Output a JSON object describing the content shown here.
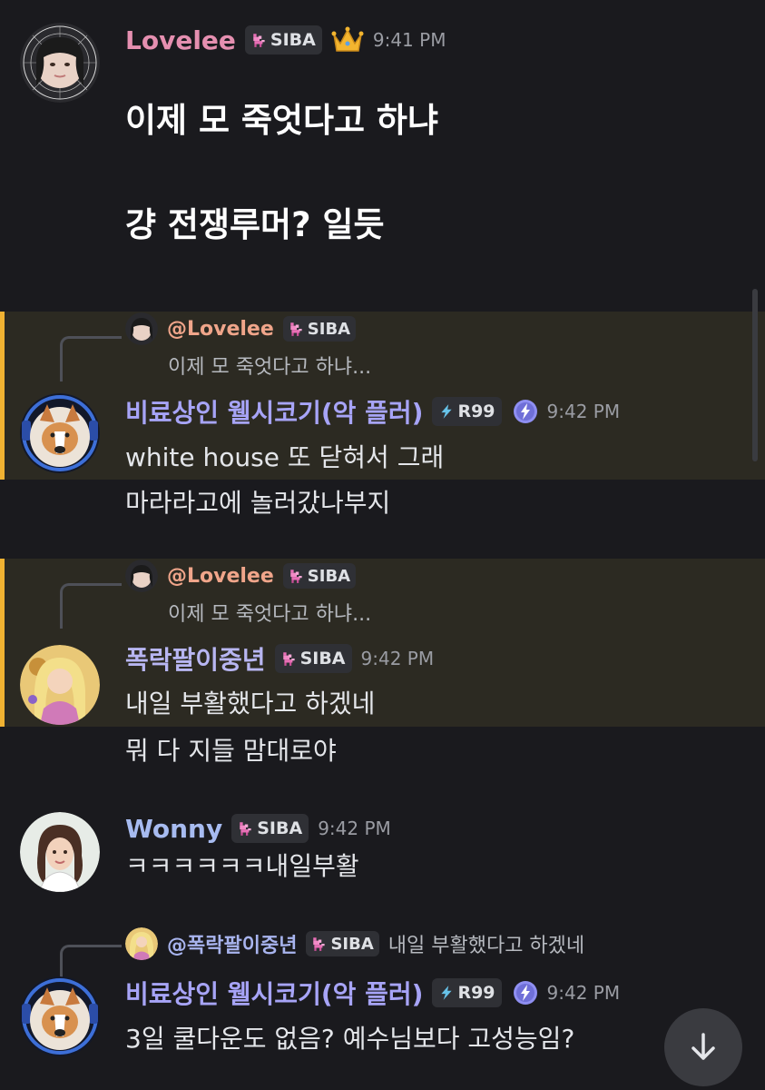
{
  "colors": {
    "lovelee": "#e58fb0",
    "corgi": "#a7a4f7",
    "popak": "#b8b6f2",
    "wonny": "#a7bbf0",
    "reply_lovelee": "#f0a58a",
    "reply_popak": "#a8b4ee",
    "highlight": "#f0b232"
  },
  "messages": [
    {
      "author": "Lovelee",
      "badge": "SIBA",
      "badge_icon": "pink-pixel-dog-icon",
      "extra_icon": "crown-icon",
      "time": "9:41 PM",
      "lines": [
        "이제 모 죽엇다고 하냐",
        "걍 전쟁루머? 일듯"
      ]
    },
    {
      "reply_to": {
        "author": "@Lovelee",
        "badge": "SIBA",
        "preview": "이제 모 죽엇다고 하냐..."
      },
      "author": "비료상인 웰시코기(악 플러)",
      "badge": "R99",
      "badge_icon": "lightning-icon",
      "extra_icon": "boost-icon",
      "time": "9:42 PM",
      "lines": [
        "white house 또 닫혀서 그래",
        "마라라고에 놀러갔나부지"
      ]
    },
    {
      "reply_to": {
        "author": "@Lovelee",
        "badge": "SIBA",
        "preview": "이제 모 죽엇다고 하냐..."
      },
      "author": "폭락팔이중년",
      "badge": "SIBA",
      "badge_icon": "pink-pixel-dog-icon",
      "time": "9:42 PM",
      "lines": [
        "내일 부활했다고 하겠네",
        "뭐 다 지들 맘대로야"
      ]
    },
    {
      "author": "Wonny",
      "badge": "SIBA",
      "badge_icon": "pink-pixel-dog-icon",
      "time": "9:42 PM",
      "lines": [
        "ㅋㅋㅋㅋㅋㅋ내일부활"
      ]
    },
    {
      "reply_to": {
        "author": "@폭락팔이중년",
        "badge": "SIBA",
        "preview": "내일 부활했다고 하겠네"
      },
      "author": "비료상인 웰시코기(악 플러)",
      "badge": "R99",
      "badge_icon": "lightning-icon",
      "extra_icon": "boost-icon",
      "time": "9:42 PM",
      "lines": [
        "3일 쿨다운도 없음? 예수님보다 고성능임?"
      ]
    }
  ],
  "jump_button": {
    "icon": "arrow-down-icon"
  }
}
